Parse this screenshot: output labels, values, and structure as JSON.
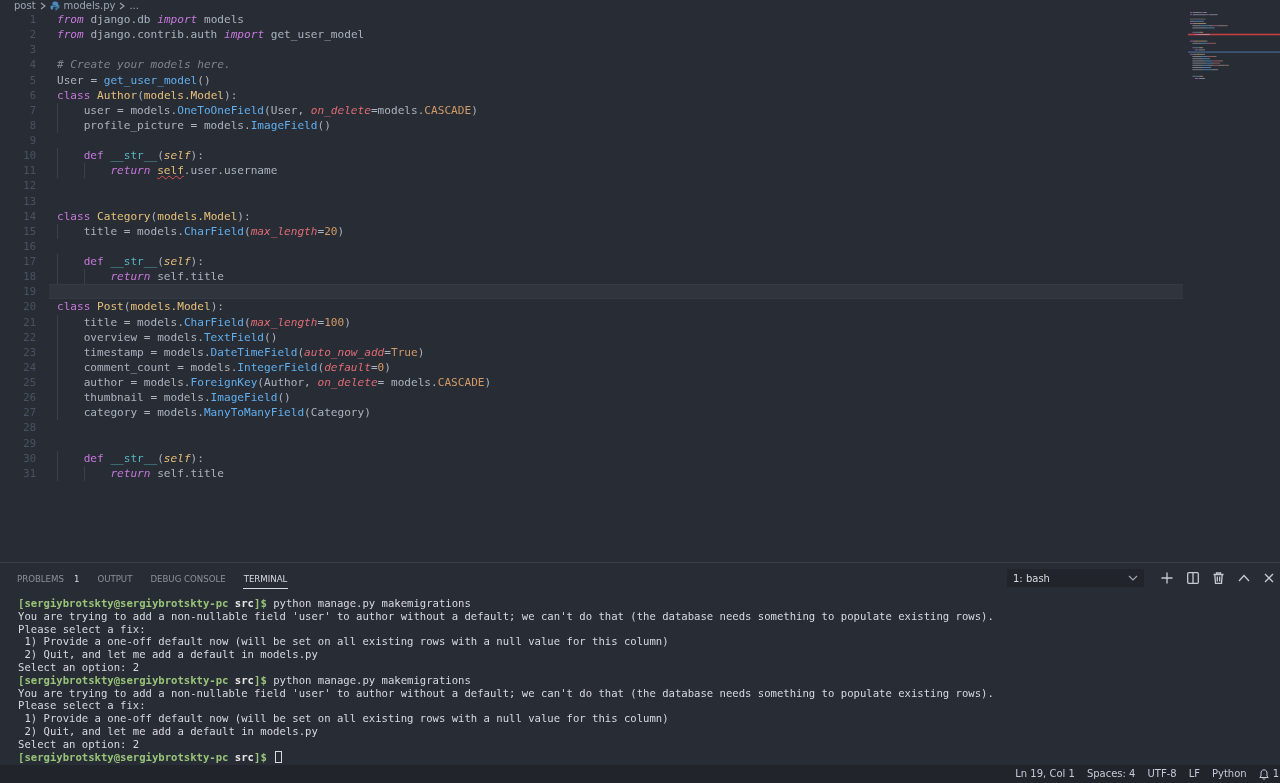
{
  "breadcrumb": [
    {
      "text": "post",
      "kind": "folder"
    },
    {
      "text": "models.py",
      "kind": "file"
    },
    {
      "text": "...",
      "kind": "more"
    }
  ],
  "editor": {
    "lines": [
      {
        "number": "1",
        "current": false,
        "tokens": [
          {
            "kind": "keyword",
            "text": "from"
          },
          {
            "kind": "plain",
            "text": " django.db "
          },
          {
            "kind": "keyword",
            "text": "import"
          },
          {
            "kind": "plain",
            "text": " models"
          }
        ]
      },
      {
        "number": "2",
        "current": false,
        "tokens": [
          {
            "kind": "keyword",
            "text": "from"
          },
          {
            "kind": "plain",
            "text": " django.contrib.auth "
          },
          {
            "kind": "keyword",
            "text": "import"
          },
          {
            "kind": "plain",
            "text": " get_user_model"
          }
        ]
      },
      {
        "number": "3",
        "current": false
      },
      {
        "number": "4",
        "current": false,
        "tokens": [
          {
            "kind": "comment",
            "text": "# Create your models here."
          }
        ]
      },
      {
        "number": "5",
        "current": false,
        "tokens": [
          {
            "kind": "plain",
            "text": "User = "
          },
          {
            "kind": "function",
            "text": "get_user_model"
          },
          {
            "kind": "plain",
            "text": "()"
          }
        ]
      },
      {
        "number": "6",
        "current": false,
        "tokens": [
          {
            "kind": "storage",
            "text": "class "
          },
          {
            "kind": "class",
            "text": "Author"
          },
          {
            "kind": "plain",
            "text": "("
          },
          {
            "kind": "class",
            "text": "models.Model"
          },
          {
            "kind": "plain",
            "text": "):"
          }
        ]
      },
      {
        "number": "7",
        "current": false,
        "tokens": [
          {
            "kind": "plain",
            "text": "    user = models."
          },
          {
            "kind": "function",
            "text": "OneToOneField"
          },
          {
            "kind": "plain",
            "text": "(User, "
          },
          {
            "kind": "parameter",
            "text": "on_delete"
          },
          {
            "kind": "plain",
            "text": "=models."
          },
          {
            "kind": "constant",
            "text": "CASCADE"
          },
          {
            "kind": "plain",
            "text": ")"
          }
        ]
      },
      {
        "number": "8",
        "current": false,
        "tokens": [
          {
            "kind": "plain",
            "text": "    profile_picture = models."
          },
          {
            "kind": "function",
            "text": "ImageField"
          },
          {
            "kind": "plain",
            "text": "()"
          }
        ]
      },
      {
        "number": "9",
        "current": false
      },
      {
        "number": "10",
        "current": false,
        "tokens": [
          {
            "kind": "storage",
            "text": "    def "
          },
          {
            "kind": "magic",
            "text": "__str__"
          },
          {
            "kind": "plain",
            "text": "("
          },
          {
            "kind": "self",
            "text": "self"
          },
          {
            "kind": "plain",
            "text": "):"
          }
        ]
      },
      {
        "number": "11",
        "current": false,
        "tokens": [
          {
            "kind": "keyword",
            "text": "        return "
          },
          {
            "kind": "error",
            "text": "self"
          },
          {
            "kind": "plain",
            "text": ".user.username"
          }
        ]
      },
      {
        "number": "12",
        "current": false
      },
      {
        "number": "13",
        "current": false
      },
      {
        "number": "14",
        "current": false,
        "tokens": [
          {
            "kind": "storage",
            "text": "class "
          },
          {
            "kind": "class",
            "text": "Category"
          },
          {
            "kind": "plain",
            "text": "("
          },
          {
            "kind": "class",
            "text": "models.Model"
          },
          {
            "kind": "plain",
            "text": "):"
          }
        ]
      },
      {
        "number": "15",
        "current": false,
        "tokens": [
          {
            "kind": "plain",
            "text": "    title = models."
          },
          {
            "kind": "function",
            "text": "CharField"
          },
          {
            "kind": "plain",
            "text": "("
          },
          {
            "kind": "parameter",
            "text": "max_length"
          },
          {
            "kind": "plain",
            "text": "="
          },
          {
            "kind": "constant",
            "text": "20"
          },
          {
            "kind": "plain",
            "text": ")"
          }
        ]
      },
      {
        "number": "16",
        "current": false
      },
      {
        "number": "17",
        "current": false,
        "tokens": [
          {
            "kind": "storage",
            "text": "    def "
          },
          {
            "kind": "magic",
            "text": "__str__"
          },
          {
            "kind": "plain",
            "text": "("
          },
          {
            "kind": "self",
            "text": "self"
          },
          {
            "kind": "plain",
            "text": "):"
          }
        ]
      },
      {
        "number": "18",
        "current": false,
        "tokens": [
          {
            "kind": "keyword",
            "text": "        return"
          },
          {
            "kind": "plain",
            "text": " self.title"
          }
        ]
      },
      {
        "number": "19",
        "current": true
      },
      {
        "number": "20",
        "current": false,
        "tokens": [
          {
            "kind": "storage",
            "text": "class "
          },
          {
            "kind": "class",
            "text": "Post"
          },
          {
            "kind": "plain",
            "text": "("
          },
          {
            "kind": "class",
            "text": "models.Model"
          },
          {
            "kind": "plain",
            "text": "):"
          }
        ]
      },
      {
        "number": "21",
        "current": false,
        "tokens": [
          {
            "kind": "plain",
            "text": "    title = models."
          },
          {
            "kind": "function",
            "text": "CharField"
          },
          {
            "kind": "plain",
            "text": "("
          },
          {
            "kind": "parameter",
            "text": "max_length"
          },
          {
            "kind": "plain",
            "text": "="
          },
          {
            "kind": "constant",
            "text": "100"
          },
          {
            "kind": "plain",
            "text": ")"
          }
        ]
      },
      {
        "number": "22",
        "current": false,
        "tokens": [
          {
            "kind": "plain",
            "text": "    overview = models."
          },
          {
            "kind": "function",
            "text": "TextField"
          },
          {
            "kind": "plain",
            "text": "()"
          }
        ]
      },
      {
        "number": "23",
        "current": false,
        "tokens": [
          {
            "kind": "plain",
            "text": "    timestamp = models."
          },
          {
            "kind": "function",
            "text": "DateTimeField"
          },
          {
            "kind": "plain",
            "text": "("
          },
          {
            "kind": "parameter",
            "text": "auto_now_add"
          },
          {
            "kind": "plain",
            "text": "="
          },
          {
            "kind": "constant",
            "text": "True"
          },
          {
            "kind": "plain",
            "text": ")"
          }
        ]
      },
      {
        "number": "24",
        "current": false,
        "tokens": [
          {
            "kind": "plain",
            "text": "    comment_count = models."
          },
          {
            "kind": "function",
            "text": "IntegerField"
          },
          {
            "kind": "plain",
            "text": "("
          },
          {
            "kind": "parameter",
            "text": "default"
          },
          {
            "kind": "plain",
            "text": "="
          },
          {
            "kind": "constant",
            "text": "0"
          },
          {
            "kind": "plain",
            "text": ")"
          }
        ]
      },
      {
        "number": "25",
        "current": false,
        "tokens": [
          {
            "kind": "plain",
            "text": "    author = models."
          },
          {
            "kind": "function",
            "text": "ForeignKey"
          },
          {
            "kind": "plain",
            "text": "(Author, "
          },
          {
            "kind": "parameter",
            "text": "on_delete"
          },
          {
            "kind": "plain",
            "text": "= models."
          },
          {
            "kind": "constant",
            "text": "CASCADE"
          },
          {
            "kind": "plain",
            "text": ")"
          }
        ]
      },
      {
        "number": "26",
        "current": false,
        "tokens": [
          {
            "kind": "plain",
            "text": "    thumbnail = models."
          },
          {
            "kind": "function",
            "text": "ImageField"
          },
          {
            "kind": "plain",
            "text": "()"
          }
        ]
      },
      {
        "number": "27",
        "current": false,
        "tokens": [
          {
            "kind": "plain",
            "text": "    category = models."
          },
          {
            "kind": "function",
            "text": "ManyToManyField"
          },
          {
            "kind": "plain",
            "text": "(Category)"
          }
        ]
      },
      {
        "number": "28",
        "current": false
      },
      {
        "number": "29",
        "current": false
      },
      {
        "number": "30",
        "current": false,
        "tokens": [
          {
            "kind": "storage",
            "text": "    def "
          },
          {
            "kind": "magic",
            "text": "__str__"
          },
          {
            "kind": "plain",
            "text": "("
          },
          {
            "kind": "self",
            "text": "self"
          },
          {
            "kind": "plain",
            "text": "):"
          }
        ]
      },
      {
        "number": "31",
        "current": false,
        "tokens": [
          {
            "kind": "keyword",
            "text": "        return"
          },
          {
            "kind": "plain",
            "text": " self.title"
          }
        ]
      }
    ]
  },
  "panel": {
    "tabs": [
      {
        "label": "PROBLEMS",
        "count": "1",
        "selected": false
      },
      {
        "label": "OUTPUT",
        "selected": false
      },
      {
        "label": "DEBUG CONSOLE",
        "selected": false
      },
      {
        "label": "TERMINAL",
        "selected": true
      }
    ],
    "terminal_select": "1: bash",
    "terminal": [
      {
        "kind": "prompt",
        "user": "[sergiybrotskty@sergiybrotskty-pc",
        "dir": "src",
        "end": "]$",
        "command": " python manage.py makemigrations",
        "cursor": false
      },
      {
        "kind": "output",
        "text": "You are trying to add a non-nullable field 'user' to author without a default; we can't do that (the database needs something to populate existing rows)."
      },
      {
        "kind": "output",
        "text": "Please select a fix:"
      },
      {
        "kind": "output",
        "text": " 1) Provide a one-off default now (will be set on all existing rows with a null value for this column)"
      },
      {
        "kind": "output",
        "text": " 2) Quit, and let me add a default in models.py"
      },
      {
        "kind": "output",
        "text": "Select an option: 2"
      },
      {
        "kind": "prompt",
        "user": "[sergiybrotskty@sergiybrotskty-pc",
        "dir": "src",
        "end": "]$",
        "command": " python manage.py makemigrations",
        "cursor": false
      },
      {
        "kind": "output",
        "text": "You are trying to add a non-nullable field 'user' to author without a default; we can't do that (the database needs something to populate existing rows)."
      },
      {
        "kind": "output",
        "text": "Please select a fix:"
      },
      {
        "kind": "output",
        "text": " 1) Provide a one-off default now (will be set on all existing rows with a null value for this column)"
      },
      {
        "kind": "output",
        "text": " 2) Quit, and let me add a default in models.py"
      },
      {
        "kind": "output",
        "text": "Select an option: 2"
      },
      {
        "kind": "prompt",
        "user": "[sergiybrotskty@sergiybrotskty-pc",
        "dir": "src",
        "end": "]$",
        "cursor": true
      }
    ]
  },
  "status_bar": {
    "items": [
      "Ln 19, Col 1",
      "Spaces: 4",
      "UTF-8",
      "LF",
      "Python"
    ],
    "notifications": "1"
  }
}
